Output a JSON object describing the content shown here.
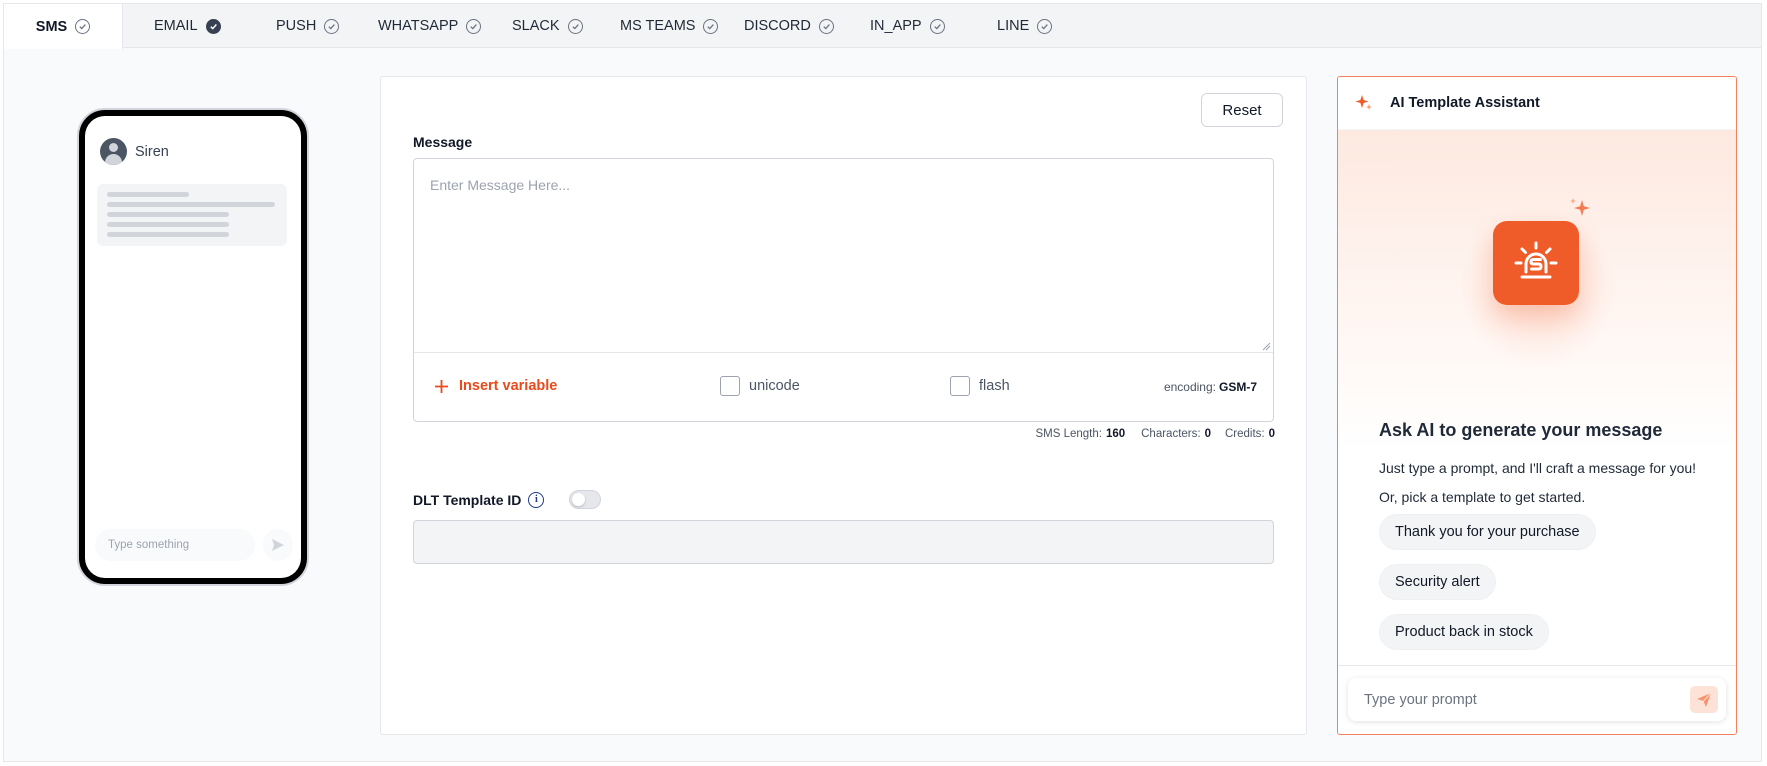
{
  "tabs": [
    {
      "label": "SMS",
      "active": true,
      "check": "outline"
    },
    {
      "label": "EMAIL",
      "active": false,
      "check": "filled"
    },
    {
      "label": "PUSH",
      "active": false,
      "check": "outline"
    },
    {
      "label": "WHATSAPP",
      "active": false,
      "check": "outline"
    },
    {
      "label": "SLACK",
      "active": false,
      "check": "outline"
    },
    {
      "label": "MS TEAMS",
      "active": false,
      "check": "outline"
    },
    {
      "label": "DISCORD",
      "active": false,
      "check": "outline"
    },
    {
      "label": "IN_APP",
      "active": false,
      "check": "outline"
    },
    {
      "label": "LINE",
      "active": false,
      "check": "outline"
    }
  ],
  "phone": {
    "sender_name": "Siren",
    "input_placeholder": "Type something"
  },
  "editor": {
    "reset_label": "Reset",
    "message_label": "Message",
    "message_placeholder": "Enter Message Here...",
    "message_value": "",
    "insert_variable_label": "Insert variable",
    "unicode_label": "unicode",
    "unicode_checked": false,
    "flash_label": "flash",
    "flash_checked": false,
    "encoding_label": "encoding:",
    "encoding_value": "GSM-7",
    "sms_length_label": "SMS Length:",
    "sms_length_value": "160",
    "characters_label": "Characters:",
    "characters_value": "0",
    "credits_label": "Credits:",
    "credits_value": "0",
    "dlt_label": "DLT Template ID",
    "dlt_info_glyph": "i",
    "dlt_enabled": false,
    "dlt_value": ""
  },
  "ai": {
    "title": "AI Template Assistant",
    "heading": "Ask AI to generate your message",
    "sub1": "Just type a prompt, and I'll craft a message for you!",
    "sub2": "Or, pick a template to get started.",
    "templates": [
      "Thank you for your purchase",
      "Security alert",
      "Product back in stock"
    ],
    "prompt_placeholder": "Type your prompt"
  },
  "colors": {
    "accent": "#ea4a1c",
    "ai_logo": "#ef5c2a",
    "ai_border": "#f0815c"
  }
}
